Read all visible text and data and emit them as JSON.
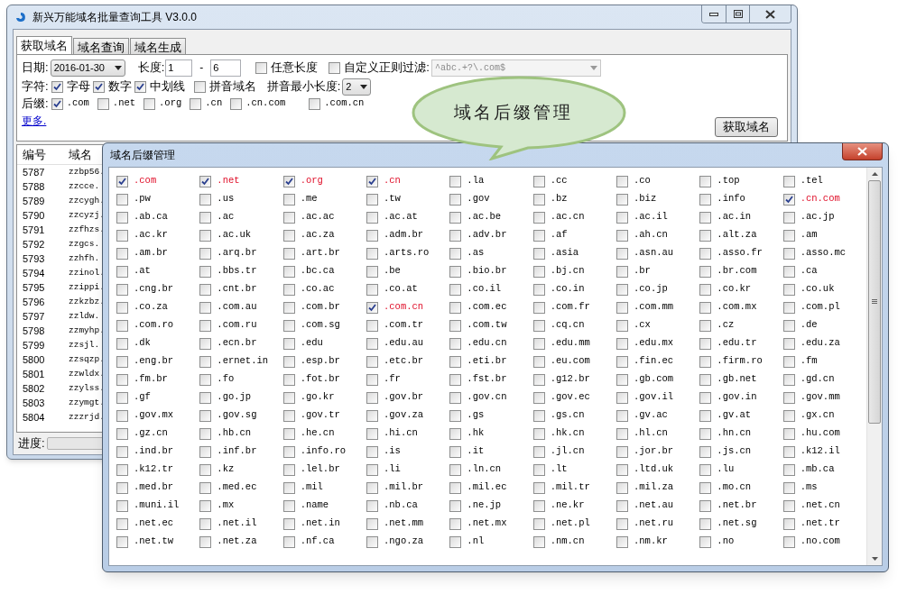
{
  "main_window": {
    "title": "新兴万能域名批量查询工具 V3.0.0",
    "tabs": [
      {
        "label": "获取域名",
        "selected": true
      },
      {
        "label": "域名查询",
        "selected": false
      },
      {
        "label": "域名生成",
        "selected": false
      }
    ],
    "date": {
      "label": "日期:",
      "value": "2016-01-30"
    },
    "length": {
      "label": "长度:",
      "min": "1",
      "separator": "-",
      "max": "6"
    },
    "options": [
      {
        "label": "任意长度",
        "checked": false
      },
      {
        "label": "自定义正则过滤:",
        "checked": false
      }
    ],
    "regex_filter": {
      "value": "^abc.+?\\.com$",
      "disabled": true
    },
    "chars": {
      "label": "字符:",
      "items": [
        {
          "label": "字母",
          "checked": true
        },
        {
          "label": "数字",
          "checked": true
        },
        {
          "label": "中划线",
          "checked": true
        },
        {
          "label": "拼音域名",
          "checked": false
        }
      ]
    },
    "pinyin_min_length": {
      "label": "拼音最小长度:",
      "value": "2"
    },
    "suffixes": {
      "label": "后缀:",
      "items": [
        {
          "label": ".com",
          "checked": true
        },
        {
          "label": ".net",
          "checked": false
        },
        {
          "label": ".org",
          "checked": false
        },
        {
          "label": ".cn",
          "checked": false
        },
        {
          "label": ".cn.com",
          "checked": false
        },
        {
          "label": ".com.cn",
          "checked": false
        }
      ]
    },
    "more_link": "更多.",
    "fetch_button": "获取域名",
    "table": {
      "columns": [
        "编号",
        "域名"
      ],
      "rows": [
        {
          "id": "5787",
          "domain": "zzbp56."
        },
        {
          "id": "5788",
          "domain": "zzcce."
        },
        {
          "id": "5789",
          "domain": "zzcygh."
        },
        {
          "id": "5790",
          "domain": "zzcyzj."
        },
        {
          "id": "5791",
          "domain": "zzfhzs."
        },
        {
          "id": "5792",
          "domain": "zzgcs."
        },
        {
          "id": "5793",
          "domain": "zzhfh."
        },
        {
          "id": "5794",
          "domain": "zzinol."
        },
        {
          "id": "5795",
          "domain": "zzippi."
        },
        {
          "id": "5796",
          "domain": "zzkzbz."
        },
        {
          "id": "5797",
          "domain": "zzldw."
        },
        {
          "id": "5798",
          "domain": "zzmyhp."
        },
        {
          "id": "5799",
          "domain": "zzsjl."
        },
        {
          "id": "5800",
          "domain": "zzsqzp."
        },
        {
          "id": "5801",
          "domain": "zzwldx."
        },
        {
          "id": "5802",
          "domain": "zzylss."
        },
        {
          "id": "5803",
          "domain": "zzymgt."
        },
        {
          "id": "5804",
          "domain": "zzzrjd."
        }
      ]
    },
    "progress": {
      "label": "进度:",
      "level": 0
    }
  },
  "dialog": {
    "title": "域名后缀管理",
    "suffixes": [
      {
        "label": ".com",
        "checked": true
      },
      {
        "label": ".net",
        "checked": true
      },
      {
        "label": ".org",
        "checked": true
      },
      {
        "label": ".cn",
        "checked": true
      },
      {
        "label": ".la",
        "checked": false
      },
      {
        "label": ".cc",
        "checked": false
      },
      {
        "label": ".co",
        "checked": false
      },
      {
        "label": ".top",
        "checked": false
      },
      {
        "label": ".tel",
        "checked": false
      },
      {
        "label": ".pw",
        "checked": false
      },
      {
        "label": ".us",
        "checked": false
      },
      {
        "label": ".me",
        "checked": false
      },
      {
        "label": ".tw",
        "checked": false
      },
      {
        "label": ".gov",
        "checked": false
      },
      {
        "label": ".bz",
        "checked": false
      },
      {
        "label": ".biz",
        "checked": false
      },
      {
        "label": ".info",
        "checked": false
      },
      {
        "label": ".cn.com",
        "checked": true
      },
      {
        "label": ".ab.ca",
        "checked": false
      },
      {
        "label": ".ac",
        "checked": false
      },
      {
        "label": ".ac.ac",
        "checked": false
      },
      {
        "label": ".ac.at",
        "checked": false
      },
      {
        "label": ".ac.be",
        "checked": false
      },
      {
        "label": ".ac.cn",
        "checked": false
      },
      {
        "label": ".ac.il",
        "checked": false
      },
      {
        "label": ".ac.in",
        "checked": false
      },
      {
        "label": ".ac.jp",
        "checked": false
      },
      {
        "label": ".ac.kr",
        "checked": false
      },
      {
        "label": ".ac.uk",
        "checked": false
      },
      {
        "label": ".ac.za",
        "checked": false
      },
      {
        "label": ".adm.br",
        "checked": false
      },
      {
        "label": ".adv.br",
        "checked": false
      },
      {
        "label": ".af",
        "checked": false
      },
      {
        "label": ".ah.cn",
        "checked": false
      },
      {
        "label": ".alt.za",
        "checked": false
      },
      {
        "label": ".am",
        "checked": false
      },
      {
        "label": ".am.br",
        "checked": false
      },
      {
        "label": ".arq.br",
        "checked": false
      },
      {
        "label": ".art.br",
        "checked": false
      },
      {
        "label": ".arts.ro",
        "checked": false
      },
      {
        "label": ".as",
        "checked": false
      },
      {
        "label": ".asia",
        "checked": false
      },
      {
        "label": ".asn.au",
        "checked": false
      },
      {
        "label": ".asso.fr",
        "checked": false
      },
      {
        "label": ".asso.mc",
        "checked": false
      },
      {
        "label": ".at",
        "checked": false
      },
      {
        "label": ".bbs.tr",
        "checked": false
      },
      {
        "label": ".bc.ca",
        "checked": false
      },
      {
        "label": ".be",
        "checked": false
      },
      {
        "label": ".bio.br",
        "checked": false
      },
      {
        "label": ".bj.cn",
        "checked": false
      },
      {
        "label": ".br",
        "checked": false
      },
      {
        "label": ".br.com",
        "checked": false
      },
      {
        "label": ".ca",
        "checked": false
      },
      {
        "label": ".cng.br",
        "checked": false
      },
      {
        "label": ".cnt.br",
        "checked": false
      },
      {
        "label": ".co.ac",
        "checked": false
      },
      {
        "label": ".co.at",
        "checked": false
      },
      {
        "label": ".co.il",
        "checked": false
      },
      {
        "label": ".co.in",
        "checked": false
      },
      {
        "label": ".co.jp",
        "checked": false
      },
      {
        "label": ".co.kr",
        "checked": false
      },
      {
        "label": ".co.uk",
        "checked": false
      },
      {
        "label": ".co.za",
        "checked": false
      },
      {
        "label": ".com.au",
        "checked": false
      },
      {
        "label": ".com.br",
        "checked": false
      },
      {
        "label": ".com.cn",
        "checked": true
      },
      {
        "label": ".com.ec",
        "checked": false
      },
      {
        "label": ".com.fr",
        "checked": false
      },
      {
        "label": ".com.mm",
        "checked": false
      },
      {
        "label": ".com.mx",
        "checked": false
      },
      {
        "label": ".com.pl",
        "checked": false
      },
      {
        "label": ".com.ro",
        "checked": false
      },
      {
        "label": ".com.ru",
        "checked": false
      },
      {
        "label": ".com.sg",
        "checked": false
      },
      {
        "label": ".com.tr",
        "checked": false
      },
      {
        "label": ".com.tw",
        "checked": false
      },
      {
        "label": ".cq.cn",
        "checked": false
      },
      {
        "label": ".cx",
        "checked": false
      },
      {
        "label": ".cz",
        "checked": false
      },
      {
        "label": ".de",
        "checked": false
      },
      {
        "label": ".dk",
        "checked": false
      },
      {
        "label": ".ecn.br",
        "checked": false
      },
      {
        "label": ".edu",
        "checked": false
      },
      {
        "label": ".edu.au",
        "checked": false
      },
      {
        "label": ".edu.cn",
        "checked": false
      },
      {
        "label": ".edu.mm",
        "checked": false
      },
      {
        "label": ".edu.mx",
        "checked": false
      },
      {
        "label": ".edu.tr",
        "checked": false
      },
      {
        "label": ".edu.za",
        "checked": false
      },
      {
        "label": ".eng.br",
        "checked": false
      },
      {
        "label": ".ernet.in",
        "checked": false
      },
      {
        "label": ".esp.br",
        "checked": false
      },
      {
        "label": ".etc.br",
        "checked": false
      },
      {
        "label": ".eti.br",
        "checked": false
      },
      {
        "label": ".eu.com",
        "checked": false
      },
      {
        "label": ".fin.ec",
        "checked": false
      },
      {
        "label": ".firm.ro",
        "checked": false
      },
      {
        "label": ".fm",
        "checked": false
      },
      {
        "label": ".fm.br",
        "checked": false
      },
      {
        "label": ".fo",
        "checked": false
      },
      {
        "label": ".fot.br",
        "checked": false
      },
      {
        "label": ".fr",
        "checked": false
      },
      {
        "label": ".fst.br",
        "checked": false
      },
      {
        "label": ".g12.br",
        "checked": false
      },
      {
        "label": ".gb.com",
        "checked": false
      },
      {
        "label": ".gb.net",
        "checked": false
      },
      {
        "label": ".gd.cn",
        "checked": false
      },
      {
        "label": ".gf",
        "checked": false
      },
      {
        "label": ".go.jp",
        "checked": false
      },
      {
        "label": ".go.kr",
        "checked": false
      },
      {
        "label": ".gov.br",
        "checked": false
      },
      {
        "label": ".gov.cn",
        "checked": false
      },
      {
        "label": ".gov.ec",
        "checked": false
      },
      {
        "label": ".gov.il",
        "checked": false
      },
      {
        "label": ".gov.in",
        "checked": false
      },
      {
        "label": ".gov.mm",
        "checked": false
      },
      {
        "label": ".gov.mx",
        "checked": false
      },
      {
        "label": ".gov.sg",
        "checked": false
      },
      {
        "label": ".gov.tr",
        "checked": false
      },
      {
        "label": ".gov.za",
        "checked": false
      },
      {
        "label": ".gs",
        "checked": false
      },
      {
        "label": ".gs.cn",
        "checked": false
      },
      {
        "label": ".gv.ac",
        "checked": false
      },
      {
        "label": ".gv.at",
        "checked": false
      },
      {
        "label": ".gx.cn",
        "checked": false
      },
      {
        "label": ".gz.cn",
        "checked": false
      },
      {
        "label": ".hb.cn",
        "checked": false
      },
      {
        "label": ".he.cn",
        "checked": false
      },
      {
        "label": ".hi.cn",
        "checked": false
      },
      {
        "label": ".hk",
        "checked": false
      },
      {
        "label": ".hk.cn",
        "checked": false
      },
      {
        "label": ".hl.cn",
        "checked": false
      },
      {
        "label": ".hn.cn",
        "checked": false
      },
      {
        "label": ".hu.com",
        "checked": false
      },
      {
        "label": ".ind.br",
        "checked": false
      },
      {
        "label": ".inf.br",
        "checked": false
      },
      {
        "label": ".info.ro",
        "checked": false
      },
      {
        "label": ".is",
        "checked": false
      },
      {
        "label": ".it",
        "checked": false
      },
      {
        "label": ".jl.cn",
        "checked": false
      },
      {
        "label": ".jor.br",
        "checked": false
      },
      {
        "label": ".js.cn",
        "checked": false
      },
      {
        "label": ".k12.il",
        "checked": false
      },
      {
        "label": ".k12.tr",
        "checked": false
      },
      {
        "label": ".kz",
        "checked": false
      },
      {
        "label": ".lel.br",
        "checked": false
      },
      {
        "label": ".li",
        "checked": false
      },
      {
        "label": ".ln.cn",
        "checked": false
      },
      {
        "label": ".lt",
        "checked": false
      },
      {
        "label": ".ltd.uk",
        "checked": false
      },
      {
        "label": ".lu",
        "checked": false
      },
      {
        "label": ".mb.ca",
        "checked": false
      },
      {
        "label": ".med.br",
        "checked": false
      },
      {
        "label": ".med.ec",
        "checked": false
      },
      {
        "label": ".mil",
        "checked": false
      },
      {
        "label": ".mil.br",
        "checked": false
      },
      {
        "label": ".mil.ec",
        "checked": false
      },
      {
        "label": ".mil.tr",
        "checked": false
      },
      {
        "label": ".mil.za",
        "checked": false
      },
      {
        "label": ".mo.cn",
        "checked": false
      },
      {
        "label": ".ms",
        "checked": false
      },
      {
        "label": ".muni.il",
        "checked": false
      },
      {
        "label": ".mx",
        "checked": false
      },
      {
        "label": ".name",
        "checked": false
      },
      {
        "label": ".nb.ca",
        "checked": false
      },
      {
        "label": ".ne.jp",
        "checked": false
      },
      {
        "label": ".ne.kr",
        "checked": false
      },
      {
        "label": ".net.au",
        "checked": false
      },
      {
        "label": ".net.br",
        "checked": false
      },
      {
        "label": ".net.cn",
        "checked": false
      },
      {
        "label": ".net.ec",
        "checked": false
      },
      {
        "label": ".net.il",
        "checked": false
      },
      {
        "label": ".net.in",
        "checked": false
      },
      {
        "label": ".net.mm",
        "checked": false
      },
      {
        "label": ".net.mx",
        "checked": false
      },
      {
        "label": ".net.pl",
        "checked": false
      },
      {
        "label": ".net.ru",
        "checked": false
      },
      {
        "label": ".net.sg",
        "checked": false
      },
      {
        "label": ".net.tr",
        "checked": false
      },
      {
        "label": ".net.tw",
        "checked": false
      },
      {
        "label": ".net.za",
        "checked": false
      },
      {
        "label": ".nf.ca",
        "checked": false
      },
      {
        "label": ".ngo.za",
        "checked": false
      },
      {
        "label": ".nl",
        "checked": false
      },
      {
        "label": ".nm.cn",
        "checked": false
      },
      {
        "label": ".nm.kr",
        "checked": false
      },
      {
        "label": ".no",
        "checked": false
      },
      {
        "label": ".no.com",
        "checked": false
      }
    ]
  },
  "callout": {
    "text": "域名后缀管理"
  }
}
